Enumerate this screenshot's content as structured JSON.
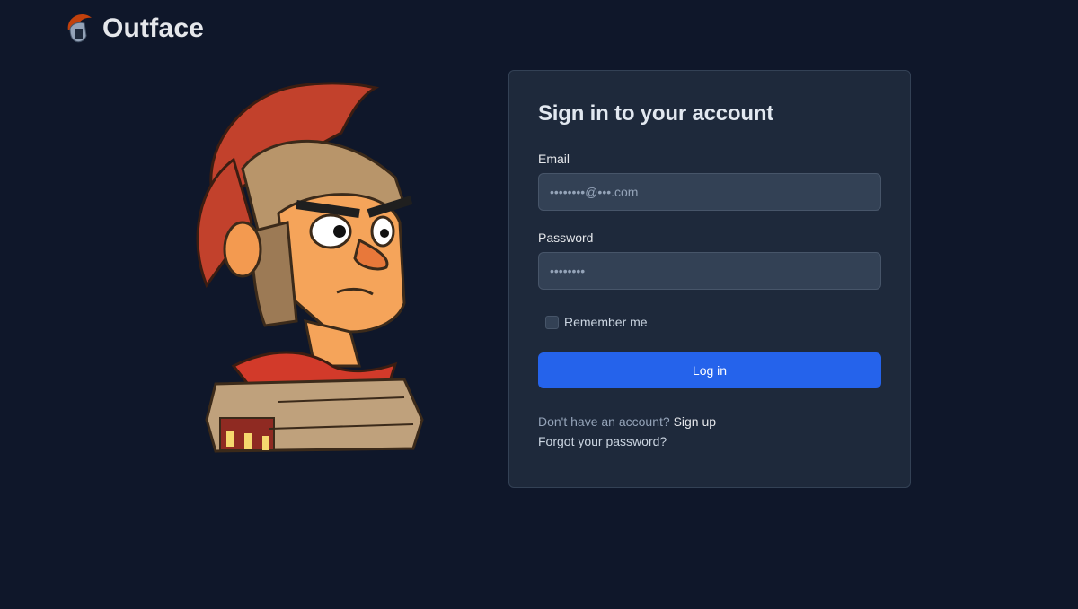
{
  "app": {
    "brand_name": "Outface"
  },
  "login_form": {
    "title": "Sign in to your account",
    "email_label": "Email",
    "email_value": "••••••••@•••.com",
    "password_label": "Password",
    "password_value": "••••••••",
    "remember_label": "Remember me",
    "submit_label": "Log in",
    "no_account_text": "Don't have an account?",
    "signup_link": "Sign up",
    "forgot_link": "Forgot your password?"
  },
  "colors": {
    "background": "#0f172a",
    "card": "#1e293b",
    "primary": "#2563eb"
  },
  "icons": {
    "logo": "roman-helmet-icon",
    "hero": "roman-soldier-illustration"
  }
}
